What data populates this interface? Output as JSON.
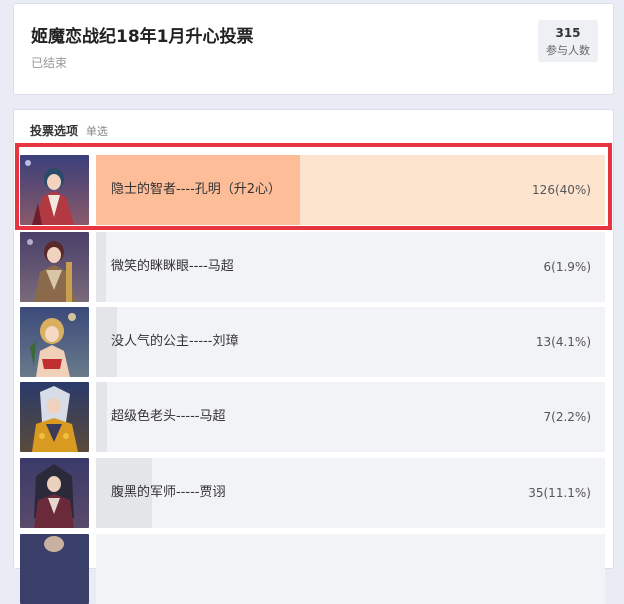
{
  "poll": {
    "title": "姬魔恋战纪18年1月升心投票",
    "status": "已结束",
    "participant_count": "315",
    "participant_label": "参与人数"
  },
  "options_section": {
    "title": "投票选项",
    "type": "单选"
  },
  "options": [
    {
      "label": "隐士的智者----孔明（升2心）",
      "result": "126(40%)",
      "percent": 40,
      "selected": true
    },
    {
      "label": "微笑的眯眯眼----马超",
      "result": "6(1.9%)",
      "percent": 1.9,
      "selected": false
    },
    {
      "label": "没人气的公主-----刘璋",
      "result": "13(4.1%)",
      "percent": 4.1,
      "selected": false
    },
    {
      "label": "超级色老头-----马超",
      "result": "7(2.2%)",
      "percent": 2.2,
      "selected": false
    },
    {
      "label": "腹黑的军师-----贾诩",
      "result": "35(11.1%)",
      "percent": 11.1,
      "selected": false
    }
  ],
  "colors": {
    "selected_fill": "#fcbd98",
    "selected_track": "#fde4cf",
    "highlight_border": "#e8343f"
  }
}
